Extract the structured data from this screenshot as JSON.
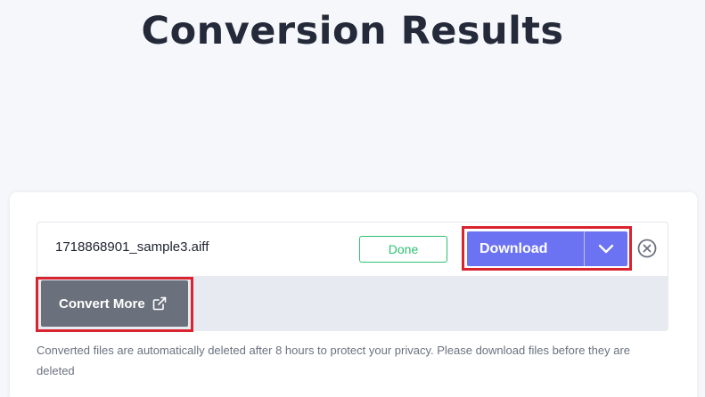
{
  "page": {
    "title": "Conversion Results"
  },
  "file": {
    "name": "1718868901_sample3.aiff",
    "status": "Done",
    "download_label": "Download"
  },
  "actions": {
    "convert_more_label": "Convert More"
  },
  "notice": "Converted files are automatically deleted after 8 hours to protect your privacy. Please download files before they are deleted",
  "colors": {
    "primary": "#6c73f2",
    "success": "#2fbf71",
    "secondary_button": "#6b717c",
    "highlight": "#d9232e",
    "title": "#252a3a"
  },
  "icons": {
    "dropdown": "chevron-down-icon",
    "remove": "close-circle-icon",
    "external": "external-link-icon"
  }
}
